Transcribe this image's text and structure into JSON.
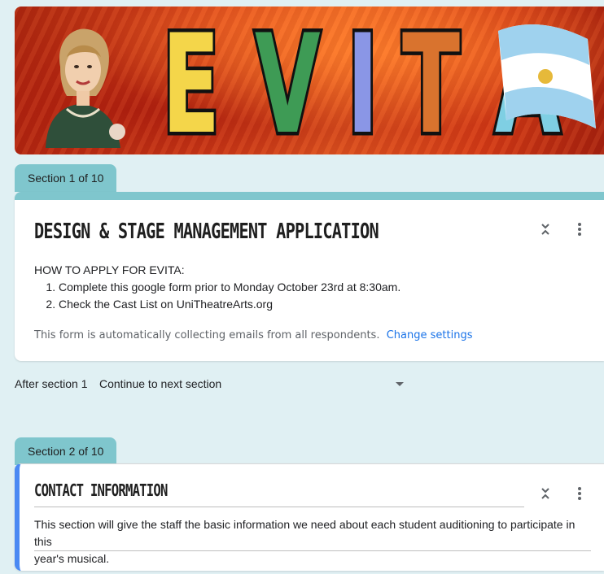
{
  "banner": {
    "letters": [
      "E",
      "V",
      "I",
      "T",
      "A"
    ],
    "letter_colors": [
      "#f4d64a",
      "#3e9b55",
      "#8a96e6",
      "#d9732e",
      "#7fcfe3"
    ]
  },
  "section1": {
    "tab_label": "Section 1 of 10",
    "title": "DESIGN & STAGE MANAGEMENT APPLICATION",
    "intro": "HOW TO APPLY FOR EVITA:",
    "steps": [
      "Complete this google form prior to Monday October 23rd at 8:30am.",
      "Check the Cast List on UniTheatreArts.org"
    ],
    "email_notice": "This form is automatically collecting emails from all respondents.",
    "change_settings": "Change settings"
  },
  "after_section": {
    "label": "After section 1",
    "value": "Continue to next section"
  },
  "section2": {
    "tab_label": "Section 2 of 10",
    "title": "CONTACT INFORMATION",
    "description_line1": "This section will give the staff the basic information we need about each student auditioning to participate in this",
    "description_line2": "year's musical."
  },
  "colors": {
    "accent_teal": "#7fc6cd",
    "active_blue": "#4a89f3",
    "link_blue": "#1a73e8"
  },
  "icons": [
    "collapse-icon",
    "more-vert-icon",
    "dropdown-arrow-icon"
  ]
}
